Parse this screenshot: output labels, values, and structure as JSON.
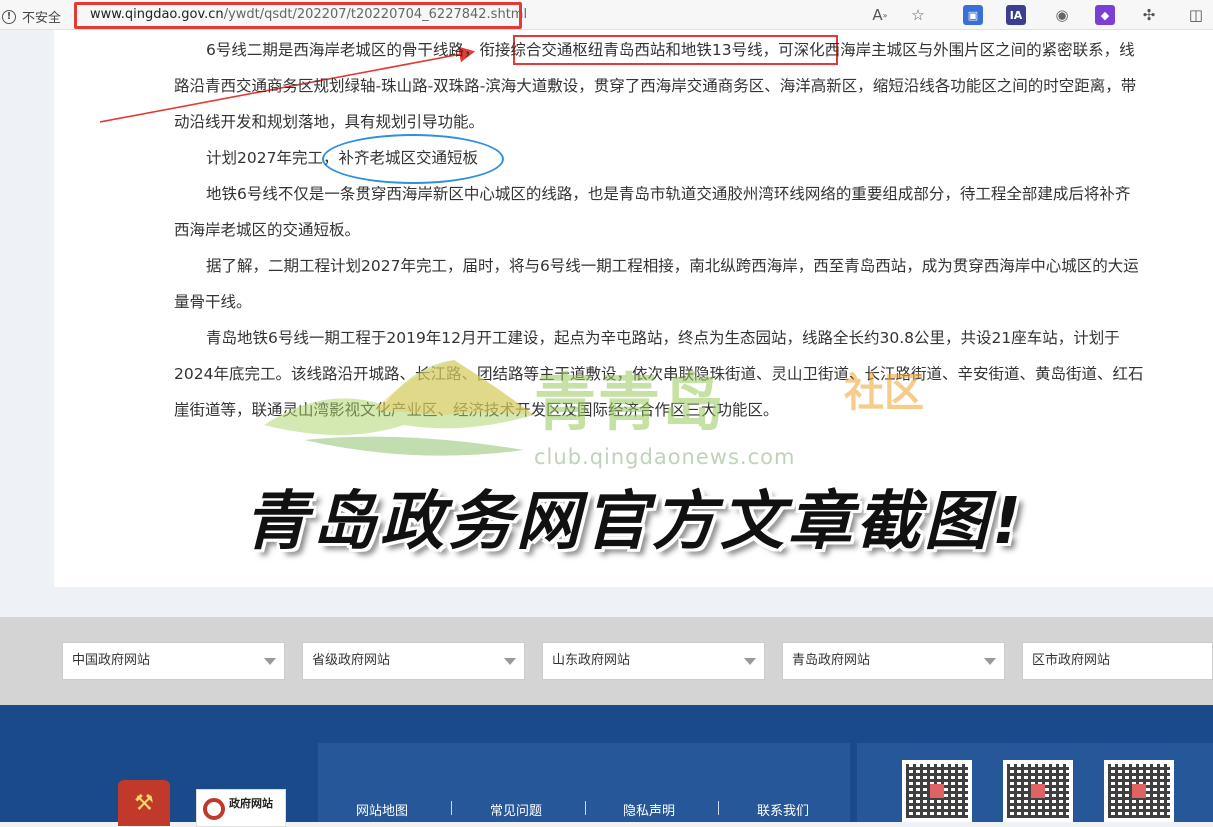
{
  "browser": {
    "insecure_label": "不安全",
    "url_domain": "www.qingdao.gov.cn",
    "url_path": "/ywdt/qsdt/202207/t20220704_6227842.shtml",
    "toolbar_icons": [
      "read-aloud-icon",
      "favorite-star-icon",
      "extension-icon",
      "ia-extension-icon",
      "extension-icon",
      "extension-icon",
      "puzzle-icon",
      "split-screen-icon"
    ],
    "ia_label": "IA"
  },
  "article": {
    "paragraphs": [
      "6号线二期是西海岸老城区的骨干线路，衔接综合交通枢纽青岛西站和地铁13号线，可深化西海岸主城区与外围片区之间的紧密联系，线路沿青西交通商务区规划绿轴-珠山路-双珠路-滨海大道敷设，贯穿了西海岸交通商务区、海洋高新区，缩短沿线各功能区之间的时空距离，带动沿线开发和规划落地，具有规划引导功能。",
      "计划2027年完工，补齐老城区交通短板",
      "地铁6号线不仅是一条贯穿西海岸新区中心城区的线路，也是青岛市轨道交通胶州湾环线网络的重要组成部分，待工程全部建成后将补齐西海岸老城区的交通短板。",
      "据了解，二期工程计划2027年完工，届时，将与6号线一期工程相接，南北纵跨西海岸，西至青岛西站，成为贯穿西海岸中心城区的大运量骨干线。",
      "青岛地铁6号线一期工程于2019年12月开工建设，起点为辛屯路站，终点为生态园站，线路全长约30.8公里，共设21座车站，计划于2024年底完工。该线路沿开城路、长江路、团结路等主干道敷设，依次串联隐珠街道、灵山卫街道、长江路街道、辛安街道、黄岛街道、红石崖街道等，联通灵山湾影视文化产业区、经济技术开发区及国际经济合作区三大功能区。"
    ],
    "watermark_title": "青青岛",
    "watermark_sub": "社区",
    "watermark_url": "club.qingdaonews.com",
    "caption": "青岛政务网官方文章截图!"
  },
  "links_bar": {
    "selects": [
      "中国政府网站",
      "省级政府网站",
      "山东政府网站",
      "青岛政府网站",
      "区市政府网站"
    ]
  },
  "footer": {
    "nav": [
      "网站地图",
      "常见问题",
      "隐私声明",
      "联系我们"
    ],
    "gov_badge_label": "政府网站",
    "colors": {
      "footer_bg": "#1b4a8a",
      "panel_bg": "#265799",
      "highlight_red": "#e53935",
      "highlight_blue": "#2f8fe0"
    }
  }
}
